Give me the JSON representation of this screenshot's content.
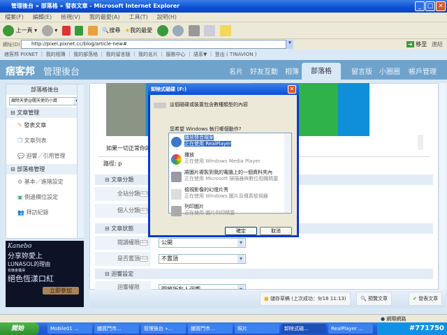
{
  "window": {
    "title": "管理後台 » 部落格 » 發表文章 - Microsoft Internet Explorer"
  },
  "menu": [
    "檔案(F)",
    "編輯(E)",
    "檢視(V)",
    "我的最愛(A)",
    "工具(T)",
    "說明(H)"
  ],
  "toolbar": {
    "back": "上一頁",
    "search": "搜尋",
    "favorites": "我的最愛"
  },
  "address": {
    "label": "網址(D)",
    "url": "http://pixel.pixnet.cc/blog/article-new#",
    "go": "移至",
    "links": "連結"
  },
  "toplinks": "痞客邦 PIXNET ｜ 我的相簿 ｜ 我的部落格 ｜ 我的留言版 ｜ 我的名片 ｜ 服務中心 ｜ 語系▼ ｜ 登出 ( TINAVION )",
  "header": {
    "logo": "痞客邦",
    "title": "管理後台",
    "nav": [
      "名片",
      "好友互動",
      "相簿",
      "部落格",
      "留言版",
      "小圈圈",
      "帳戶管理"
    ],
    "active": "部落格"
  },
  "sidebar": {
    "title": "部落格後台",
    "blog_select": "銀除天使@闇天使的小窩",
    "sections": [
      {
        "title": "文章管理",
        "items": [
          "發表文章",
          "文章列表",
          "迴響／引用管理"
        ]
      },
      {
        "title": "部落格管理",
        "items": [
          "基本／進階設定",
          "側邊欄位設定",
          "拜訪紀錄"
        ]
      }
    ]
  },
  "ad": {
    "brand": "Kanebo",
    "line1": "分享妳愛上",
    "line2": "LUNASOL的理由",
    "line3": "有機會獲得",
    "line4": "絕色恆漾口紅",
    "cta": "立即參加"
  },
  "editor": {
    "text": "如果一切正常你的",
    "path": "路徑: p"
  },
  "form": {
    "sections": [
      "文章分類",
      "文章狀態",
      "迴響設定"
    ],
    "site_category": "全站分類",
    "personal_category": "個人分類",
    "read_permission": "閱讀權限",
    "read_permission_value": "公開",
    "pin": "是否置頂",
    "pin_value": "不置頂",
    "comment_permission": "迴響權限",
    "comment_permission_value": "開放所有人迴響",
    "help": "HELP"
  },
  "actions": {
    "save_draft": "儲存草稿 (上次成功：9/16 11:13)",
    "preview": "預覽文章",
    "publish": "發表文章"
  },
  "dialog": {
    "title": "卸除式磁碟 (F:)",
    "message": "這個磁碟或裝置包含數種類型的內容",
    "question": "您希望 Windows 執行哪個動作?",
    "options": [
      {
        "title": "播放聲音檔案",
        "sub": "正在使用 RealPlayer",
        "selected": true
      },
      {
        "title": "播放",
        "sub": "正在使用 Windows Media Player"
      },
      {
        "title": "將圖片複製到我的電腦上的一個資料夾內",
        "sub": "正在使用 Microsoft 掃描器與數位相機精靈"
      },
      {
        "title": "檢視影像的幻燈片秀",
        "sub": "正在使用 Windows 圖片及傳真檢視器"
      },
      {
        "title": "列印圖片",
        "sub": "正在使用 圖片列印精靈"
      }
    ],
    "ok": "確定",
    "cancel": "取消"
  },
  "statusbar": {
    "zone": "網際網路"
  },
  "taskbar": {
    "start": "開始",
    "tasks": [
      "Mobile01 ...",
      "鋪貨門市...",
      "管理後台 »...",
      "鋪貨門市...",
      "照片",
      "卸除式磁...",
      "RealPlayer ..."
    ],
    "tray": "#771750"
  }
}
